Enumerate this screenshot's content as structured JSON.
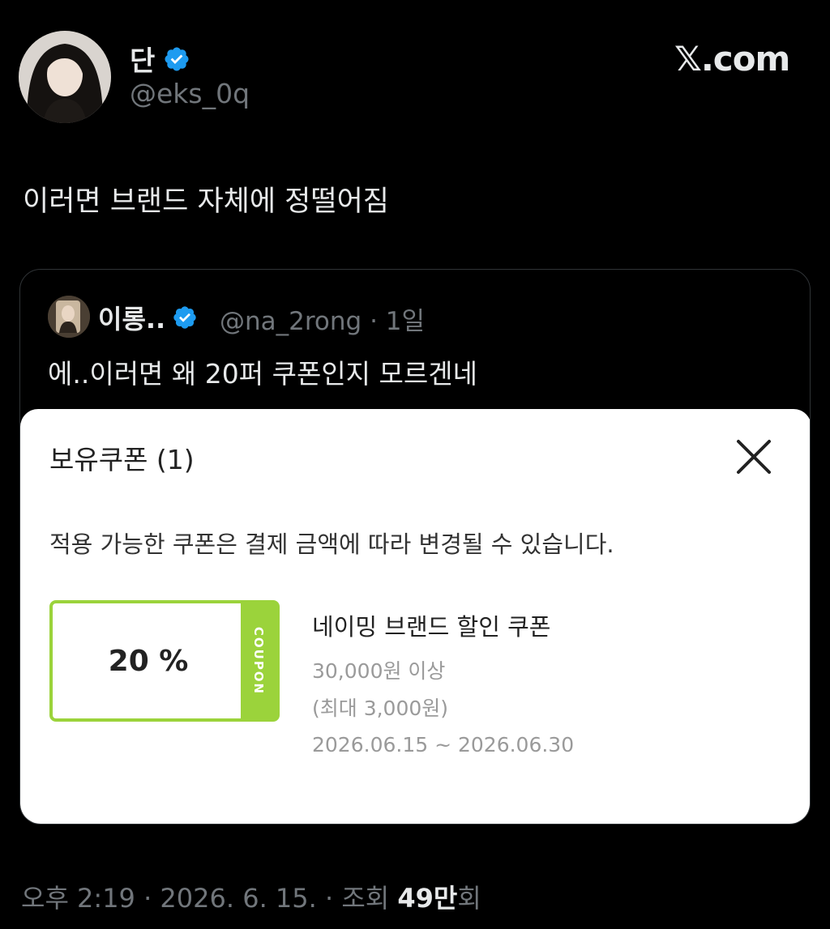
{
  "author": {
    "display_name": "단",
    "handle": "@eks_0q",
    "verified": true,
    "avatar_icon": "profile-photo"
  },
  "site_mark": "𝕏.com",
  "tweet": {
    "text": "이러면 브랜드 자체에 정떨어짐"
  },
  "quoted": {
    "display_name": "이롱..",
    "handle_meta": "@na_2rong · 1일",
    "text": "에..이러면 왜 20퍼 쿠폰인지 모르겐네",
    "image": {
      "title": "보유쿠폰 (1)",
      "close_icon": "close-icon",
      "note": "적용 가능한 쿠폰은 결제 금액에 따라 변경될 수 있습니다.",
      "coupon": {
        "value": "20 %",
        "strip_label": "COUPON",
        "name": "네이밍 브랜드 할인 쿠폰",
        "min_purchase": "30,000원 이상",
        "max_discount": "(최대 3,000원)",
        "period": "2026.06.15 ~ 2026.06.30"
      }
    }
  },
  "footer": {
    "time": "오후 2:19 · 2026. 6. 15. · 조회 ",
    "views": "49만",
    "views_suffix": "회"
  },
  "colors": {
    "background": "#000000",
    "text_primary": "#e7e9ea",
    "text_secondary": "#71767b",
    "verified_blue": "#1d9bf0",
    "coupon_green": "#9bd33b"
  }
}
